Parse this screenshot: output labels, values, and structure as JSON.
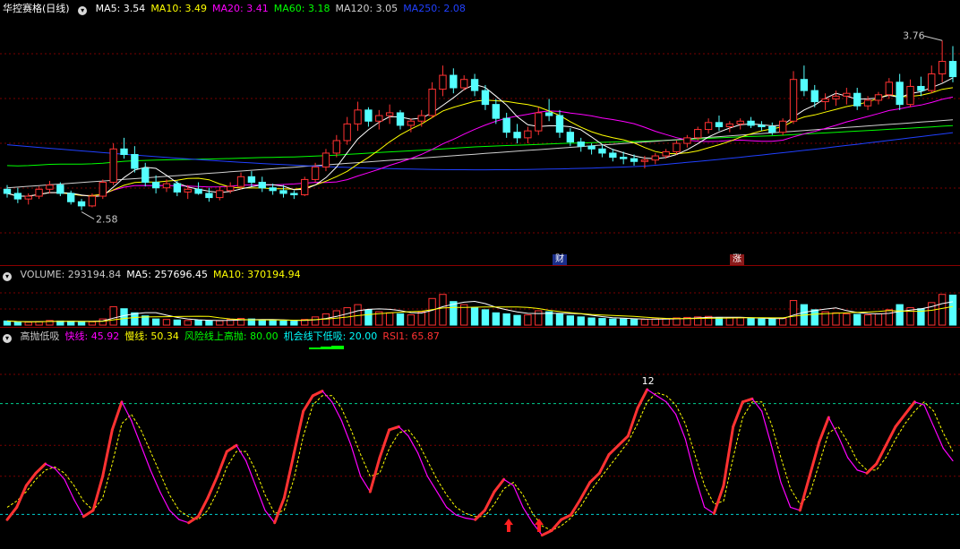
{
  "colors": {
    "up": "#ff3232",
    "down": "#54ffff",
    "ma5": "#ffffff",
    "ma10": "#ffff00",
    "ma20": "#ff00ff",
    "ma60": "#00ff00",
    "ma120": "#d0d0d0",
    "ma250": "#2040ff",
    "grid": "#7a0000",
    "fast": "#ff00ff",
    "slow": "#ffff00",
    "high_line": "#00d090",
    "low_line": "#00d0d0",
    "rsi": "#ff3232"
  },
  "price_panel": {
    "title": "华控赛格(日线)",
    "ma_labels": [
      {
        "text": "MA5: 3.54",
        "color": "#ffffff"
      },
      {
        "text": "MA10: 3.49",
        "color": "#ffff00"
      },
      {
        "text": "MA20: 3.41",
        "color": "#ff00ff"
      },
      {
        "text": "MA60: 3.18",
        "color": "#00ff00"
      },
      {
        "text": "MA120: 3.05",
        "color": "#d0d0d0"
      },
      {
        "text": "MA250: 2.08",
        "color": "#2040ff"
      }
    ],
    "high_label": "3.76",
    "low_label": "2.58",
    "tag_cai": "财",
    "tag_zhang": "涨"
  },
  "volume_panel": {
    "labels": [
      {
        "text": "VOLUME: 293194.84",
        "color": "#c8c8c8"
      },
      {
        "text": "MA5: 257696.45",
        "color": "#ffffff"
      },
      {
        "text": "MA10: 370194.94",
        "color": "#ffff00"
      }
    ]
  },
  "indicator_panel": {
    "labels": [
      {
        "text": "高抛低吸",
        "color": "#c8c8c8"
      },
      {
        "text": "快线: 45.92",
        "color": "#ff00ff"
      },
      {
        "text": "慢线: 50.34",
        "color": "#ffff00"
      },
      {
        "text": "风险线上高抛: 80.00",
        "color": "#00ff00"
      },
      {
        "text": "机会线下低吸: 20.00",
        "color": "#00ffff"
      },
      {
        "text": "RSI1: 65.87",
        "color": "#ff3232"
      }
    ],
    "peak_label": "12",
    "high_level": 80,
    "low_level": 20
  },
  "chart_data": {
    "type": "candlestick",
    "price_range": [
      2.3,
      3.95
    ],
    "candles": [
      [
        2.73,
        2.76,
        2.67,
        2.7
      ],
      [
        2.7,
        2.74,
        2.63,
        2.66
      ],
      [
        2.66,
        2.7,
        2.62,
        2.68
      ],
      [
        2.68,
        2.75,
        2.66,
        2.73
      ],
      [
        2.73,
        2.79,
        2.7,
        2.76
      ],
      [
        2.76,
        2.78,
        2.68,
        2.7
      ],
      [
        2.7,
        2.72,
        2.62,
        2.64
      ],
      [
        2.64,
        2.66,
        2.58,
        2.61
      ],
      [
        2.61,
        2.7,
        2.6,
        2.68
      ],
      [
        2.68,
        2.8,
        2.66,
        2.78
      ],
      [
        2.78,
        3.06,
        2.76,
        3.02
      ],
      [
        3.02,
        3.1,
        2.95,
        2.98
      ],
      [
        2.98,
        3.04,
        2.85,
        2.88
      ],
      [
        2.88,
        2.92,
        2.75,
        2.78
      ],
      [
        2.78,
        2.83,
        2.7,
        2.74
      ],
      [
        2.74,
        2.8,
        2.71,
        2.77
      ],
      [
        2.77,
        2.79,
        2.68,
        2.71
      ],
      [
        2.71,
        2.76,
        2.66,
        2.73
      ],
      [
        2.73,
        2.78,
        2.69,
        2.7
      ],
      [
        2.7,
        2.74,
        2.64,
        2.67
      ],
      [
        2.67,
        2.75,
        2.65,
        2.72
      ],
      [
        2.72,
        2.78,
        2.7,
        2.75
      ],
      [
        2.75,
        2.85,
        2.73,
        2.82
      ],
      [
        2.82,
        2.86,
        2.75,
        2.78
      ],
      [
        2.78,
        2.82,
        2.71,
        2.74
      ],
      [
        2.74,
        2.77,
        2.69,
        2.72
      ],
      [
        2.72,
        2.76,
        2.67,
        2.7
      ],
      [
        2.7,
        2.72,
        2.66,
        2.69
      ],
      [
        2.69,
        2.82,
        2.68,
        2.8
      ],
      [
        2.8,
        2.92,
        2.78,
        2.89
      ],
      [
        2.89,
        3.02,
        2.86,
        2.99
      ],
      [
        2.99,
        3.12,
        2.96,
        3.08
      ],
      [
        3.08,
        3.25,
        3.05,
        3.2
      ],
      [
        3.2,
        3.36,
        3.15,
        3.3
      ],
      [
        3.3,
        3.32,
        3.18,
        3.22
      ],
      [
        3.22,
        3.3,
        3.16,
        3.26
      ],
      [
        3.26,
        3.34,
        3.2,
        3.28
      ],
      [
        3.28,
        3.3,
        3.16,
        3.19
      ],
      [
        3.19,
        3.24,
        3.14,
        3.22
      ],
      [
        3.22,
        3.3,
        3.18,
        3.26
      ],
      [
        3.26,
        3.5,
        3.24,
        3.45
      ],
      [
        3.45,
        3.62,
        3.4,
        3.55
      ],
      [
        3.55,
        3.6,
        3.42,
        3.46
      ],
      [
        3.46,
        3.55,
        3.44,
        3.52
      ],
      [
        3.52,
        3.56,
        3.4,
        3.44
      ],
      [
        3.44,
        3.48,
        3.3,
        3.34
      ],
      [
        3.34,
        3.38,
        3.2,
        3.24
      ],
      [
        3.24,
        3.28,
        3.1,
        3.14
      ],
      [
        3.14,
        3.2,
        3.06,
        3.1
      ],
      [
        3.1,
        3.18,
        3.06,
        3.15
      ],
      [
        3.15,
        3.32,
        3.12,
        3.28
      ],
      [
        3.28,
        3.38,
        3.22,
        3.26
      ],
      [
        3.26,
        3.3,
        3.1,
        3.14
      ],
      [
        3.14,
        3.17,
        3.04,
        3.07
      ],
      [
        3.07,
        3.1,
        3.0,
        3.04
      ],
      [
        3.04,
        3.06,
        2.98,
        3.02
      ],
      [
        3.02,
        3.05,
        2.96,
        2.99
      ],
      [
        2.99,
        3.02,
        2.93,
        2.96
      ],
      [
        2.96,
        3.0,
        2.91,
        2.95
      ],
      [
        2.95,
        2.98,
        2.9,
        2.93
      ],
      [
        2.93,
        2.97,
        2.88,
        2.94
      ],
      [
        2.94,
        2.99,
        2.91,
        2.97
      ],
      [
        2.97,
        3.02,
        2.95,
        3.0
      ],
      [
        3.0,
        3.08,
        2.98,
        3.06
      ],
      [
        3.06,
        3.12,
        3.03,
        3.1
      ],
      [
        3.1,
        3.18,
        3.08,
        3.16
      ],
      [
        3.16,
        3.24,
        3.13,
        3.21
      ],
      [
        3.21,
        3.26,
        3.15,
        3.18
      ],
      [
        3.18,
        3.22,
        3.14,
        3.2
      ],
      [
        3.2,
        3.24,
        3.16,
        3.22
      ],
      [
        3.22,
        3.25,
        3.17,
        3.19
      ],
      [
        3.19,
        3.22,
        3.15,
        3.18
      ],
      [
        3.18,
        3.21,
        3.12,
        3.14
      ],
      [
        3.14,
        3.24,
        3.12,
        3.22
      ],
      [
        3.22,
        3.58,
        3.2,
        3.52
      ],
      [
        3.52,
        3.62,
        3.4,
        3.44
      ],
      [
        3.44,
        3.48,
        3.32,
        3.36
      ],
      [
        3.36,
        3.42,
        3.3,
        3.38
      ],
      [
        3.38,
        3.44,
        3.33,
        3.4
      ],
      [
        3.4,
        3.46,
        3.34,
        3.42
      ],
      [
        3.42,
        3.46,
        3.3,
        3.33
      ],
      [
        3.33,
        3.4,
        3.3,
        3.37
      ],
      [
        3.37,
        3.43,
        3.34,
        3.41
      ],
      [
        3.41,
        3.53,
        3.38,
        3.5
      ],
      [
        3.5,
        3.56,
        3.3,
        3.34
      ],
      [
        3.34,
        3.52,
        3.32,
        3.47
      ],
      [
        3.47,
        3.54,
        3.4,
        3.44
      ],
      [
        3.44,
        3.62,
        3.42,
        3.56
      ],
      [
        3.56,
        3.8,
        3.5,
        3.65
      ],
      [
        3.65,
        3.76,
        3.5,
        3.54
      ]
    ],
    "volume_range": [
      0,
      420000
    ],
    "volumes": [
      40000,
      30000,
      28000,
      35000,
      45000,
      40000,
      38000,
      30000,
      32000,
      60000,
      180000,
      160000,
      120000,
      90000,
      60000,
      55000,
      50000,
      45000,
      48000,
      40000,
      42000,
      55000,
      65000,
      60000,
      50000,
      45000,
      40000,
      38000,
      55000,
      80000,
      110000,
      140000,
      170000,
      200000,
      150000,
      130000,
      120000,
      110000,
      100000,
      130000,
      260000,
      300000,
      230000,
      200000,
      170000,
      150000,
      120000,
      110000,
      95000,
      100000,
      140000,
      130000,
      110000,
      90000,
      80000,
      70000,
      65000,
      60000,
      60000,
      55000,
      55000,
      60000,
      65000,
      70000,
      75000,
      80000,
      85000,
      75000,
      70000,
      70000,
      65000,
      60000,
      60000,
      65000,
      240000,
      200000,
      150000,
      130000,
      120000,
      110000,
      105000,
      100000,
      110000,
      150000,
      200000,
      170000,
      160000,
      220000,
      300000,
      293195
    ],
    "fast_line": [
      12,
      20,
      34,
      42,
      48,
      45,
      38,
      25,
      14,
      18,
      40,
      70,
      88,
      76,
      60,
      44,
      30,
      18,
      12,
      10,
      14,
      26,
      40,
      56,
      60,
      50,
      34,
      18,
      10,
      26,
      54,
      82,
      92,
      95,
      88,
      76,
      60,
      40,
      30,
      52,
      70,
      72,
      66,
      55,
      40,
      30,
      20,
      15,
      13,
      12,
      18,
      30,
      38,
      34,
      20,
      10,
      2,
      5,
      12,
      15,
      25,
      36,
      42,
      54,
      60,
      66,
      84,
      96,
      92,
      88,
      80,
      64,
      40,
      20,
      16,
      34,
      72,
      88,
      90,
      82,
      60,
      36,
      20,
      18,
      40,
      62,
      78,
      66,
      52,
      44,
      42,
      48,
      60,
      72,
      80,
      88,
      86,
      72,
      58,
      50
    ],
    "slow_line": [
      20,
      24,
      30,
      38,
      44,
      46,
      42,
      34,
      24,
      18,
      26,
      48,
      74,
      80,
      70,
      56,
      42,
      28,
      18,
      14,
      12,
      18,
      30,
      46,
      56,
      56,
      44,
      28,
      16,
      18,
      38,
      66,
      86,
      92,
      92,
      84,
      70,
      54,
      40,
      42,
      58,
      68,
      70,
      62,
      50,
      38,
      28,
      20,
      16,
      14,
      14,
      22,
      32,
      36,
      28,
      16,
      8,
      5,
      8,
      13,
      20,
      30,
      38,
      46,
      54,
      62,
      74,
      88,
      94,
      92,
      86,
      74,
      54,
      34,
      22,
      24,
      52,
      78,
      88,
      88,
      74,
      52,
      32,
      22,
      28,
      48,
      68,
      72,
      62,
      50,
      44,
      44,
      52,
      64,
      74,
      82,
      88,
      82,
      68,
      56
    ]
  }
}
